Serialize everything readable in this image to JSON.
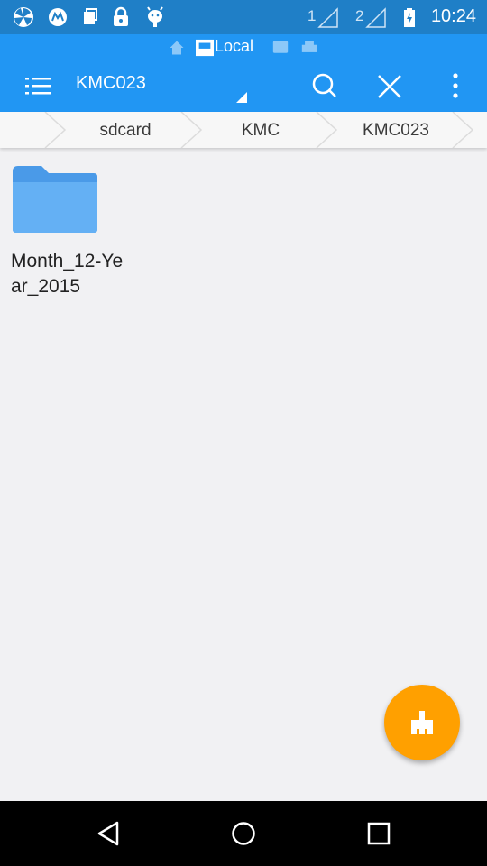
{
  "status_bar": {
    "icons": [
      "pinwheel-icon",
      "motorola-icon",
      "sim-card-icon",
      "lock-icon",
      "android-debug-icon"
    ],
    "sim1_label": "1",
    "sim2_label": "2",
    "time": "10:24"
  },
  "app_bar": {
    "location_label": "Local",
    "title": "KMC023"
  },
  "breadcrumb": {
    "items": [
      "sdcard",
      "KMC",
      "KMC023"
    ]
  },
  "folders": [
    {
      "name": "Month_12-Year_2015"
    }
  ],
  "colors": {
    "status_bar": "#1f7fc7",
    "app_bar": "#2196f3",
    "folder": "#5aaaf0",
    "fab": "#ffa000"
  }
}
